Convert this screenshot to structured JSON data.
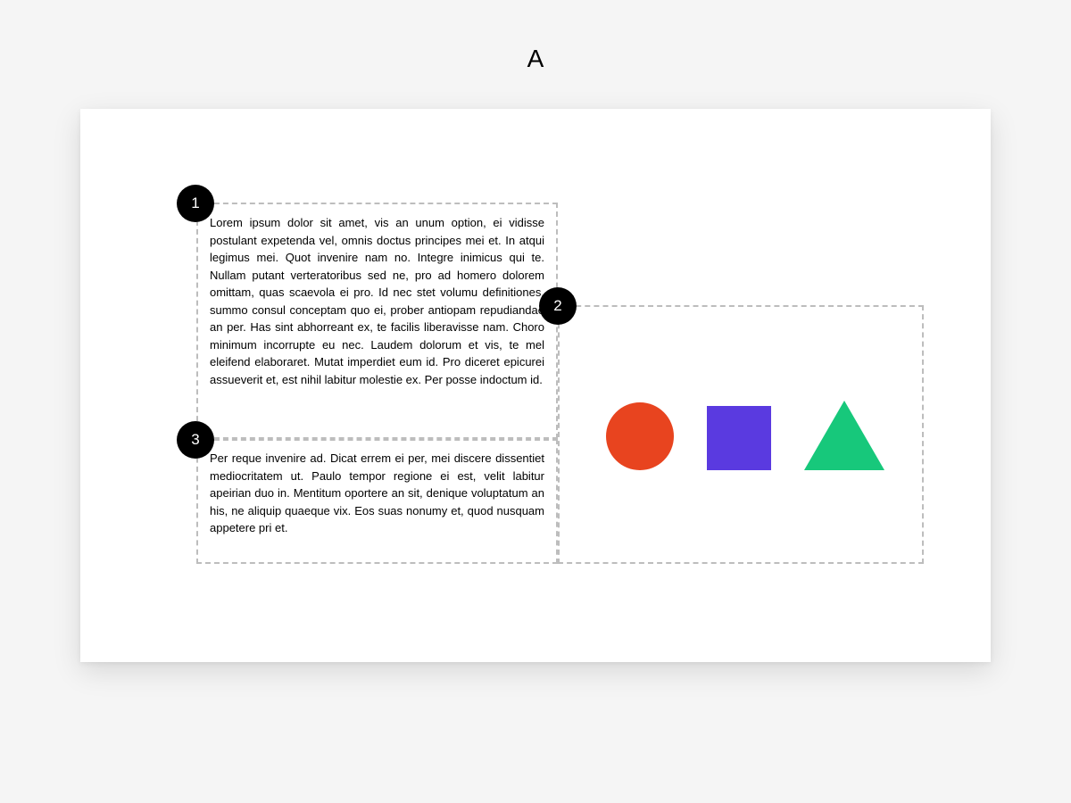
{
  "page_label": "A",
  "annotations": {
    "badge1": "1",
    "badge2": "2",
    "badge3": "3"
  },
  "blocks": {
    "text1": "Lorem ipsum dolor sit amet, vis an unum option, ei vidisse postulant expetenda vel, omnis doctus principes mei et. In atqui legimus mei. Quot invenire nam no. Integre inimicus qui te. Nullam putant verteratoribus sed ne, pro ad homero dolorem omittam, quas scaevola ei pro. Id nec stet volumu definitiones, summo consul conceptam quo ei, prober antiopam repudiandae an per. Has sint abhorreant ex, te facilis liberavisse nam. Choro minimum incorrupte eu nec. Laudem dolorum et vis, te mel eleifend elaboraret. Mutat imperdiet eum id. Pro diceret epicurei assueverit et, est nihil labitur molestie ex. Per posse indoctum id.",
    "text3": "Per reque invenire ad. Dicat errem ei per, mei discere dissentiet mediocritatem ut. Paulo tempor regione ei est, velit labitur apeirian duo in. Mentitum oportere an sit, denique voluptatum an his, ne aliquip quaeque vix. Eos suas nonumy et, quod nusquam appetere pri et."
  },
  "shapes": {
    "circle_color": "#e8441f",
    "square_color": "#5a3ae0",
    "triangle_color": "#17c87b"
  }
}
